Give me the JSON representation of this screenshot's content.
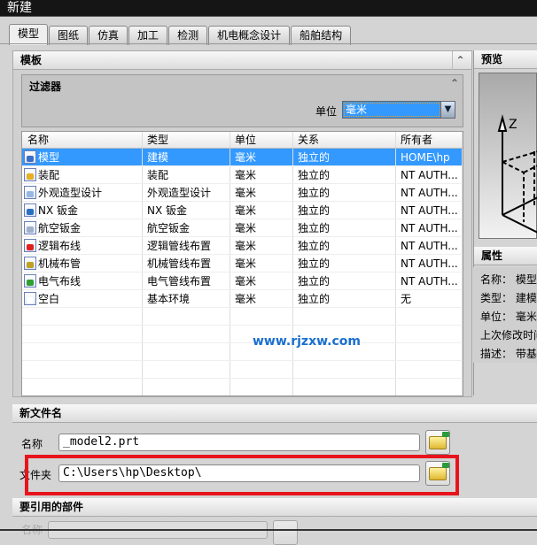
{
  "window": {
    "title": "新建"
  },
  "tabs": [
    "模型",
    "图纸",
    "仿真",
    "加工",
    "检测",
    "机电概念设计",
    "船舶结构"
  ],
  "templates": {
    "title": "模板",
    "filter": {
      "title": "过滤器",
      "unit_label": "单位",
      "unit_value": "毫米"
    },
    "columns": [
      "名称",
      "类型",
      "单位",
      "关系",
      "所有者"
    ],
    "rows": [
      {
        "name": "模型",
        "type": "建模",
        "unit": "毫米",
        "relation": "独立的",
        "owner": "HOME\\hp",
        "icon": "model-icon",
        "color": "#3a6fc8"
      },
      {
        "name": "装配",
        "type": "装配",
        "unit": "毫米",
        "relation": "独立的",
        "owner": "NT AUTH...",
        "icon": "assembly-icon",
        "color": "#e8b020"
      },
      {
        "name": "外观造型设计",
        "type": "外观造型设计",
        "unit": "毫米",
        "relation": "独立的",
        "owner": "NT AUTH...",
        "icon": "shape-studio-icon",
        "color": "#9ab6e0"
      },
      {
        "name": "NX 钣金",
        "type": "NX 钣金",
        "unit": "毫米",
        "relation": "独立的",
        "owner": "NT AUTH...",
        "icon": "sheet-metal-icon",
        "color": "#2a70c0"
      },
      {
        "name": "航空钣金",
        "type": "航空钣金",
        "unit": "毫米",
        "relation": "独立的",
        "owner": "NT AUTH...",
        "icon": "aero-sheet-metal-icon",
        "color": "#a0b0c8"
      },
      {
        "name": "逻辑布线",
        "type": "逻辑管线布置",
        "unit": "毫米",
        "relation": "独立的",
        "owner": "NT AUTH...",
        "icon": "logical-routing-icon",
        "color": "#e02020"
      },
      {
        "name": "机械布管",
        "type": "机械管线布置",
        "unit": "毫米",
        "relation": "独立的",
        "owner": "NT AUTH...",
        "icon": "mechanical-routing-icon",
        "color": "#c0a020"
      },
      {
        "name": "电气布线",
        "type": "电气管线布置",
        "unit": "毫米",
        "relation": "独立的",
        "owner": "NT AUTH...",
        "icon": "electrical-routing-icon",
        "color": "#30a030"
      },
      {
        "name": "空白",
        "type": "基本环境",
        "unit": "毫米",
        "relation": "独立的",
        "owner": "无",
        "icon": "blank-icon",
        "color": "#ffffff"
      }
    ]
  },
  "watermark": "www.rjzxw.com",
  "preview": {
    "title": "预览",
    "axis": "Z"
  },
  "properties": {
    "title": "属性",
    "items": [
      "名称： 模型",
      "类型： 建模",
      "单位： 毫米",
      "上次修改时间",
      "描述： 带基"
    ]
  },
  "new_file": {
    "title": "新文件名",
    "name_label": "名称",
    "name_value": "_model2.prt",
    "folder_label": "文件夹",
    "folder_value": "C:\\Users\\hp\\Desktop\\"
  },
  "referenced": {
    "title": "要引用的部件",
    "name_label": "名称"
  }
}
